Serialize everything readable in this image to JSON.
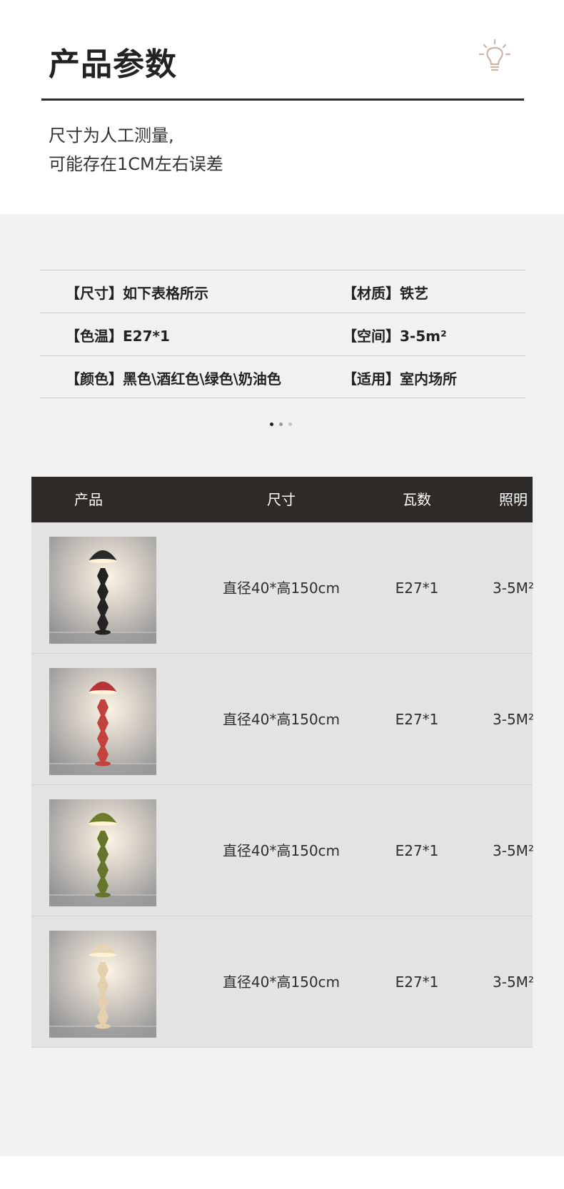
{
  "header": {
    "title": "产品参数",
    "icon": "bulb-icon",
    "note_line1": "尺寸为人工测量,",
    "note_line2": "可能存在1CM左右误差"
  },
  "specs": [
    {
      "left_key": "【尺寸】",
      "left_val": "如下表格所示",
      "right_key": "【材质】",
      "right_val": "铁艺"
    },
    {
      "left_key": "【色温】",
      "left_val": "E27*1",
      "right_key": "【空间】",
      "right_val": "3-5m²"
    },
    {
      "left_key": "【颜色】",
      "left_val": "黑色\\酒红色\\绿色\\奶油色",
      "right_key": "【适用】",
      "right_val": "室内场所"
    }
  ],
  "carousel": {
    "dots": 3,
    "active": 0
  },
  "table": {
    "headers": {
      "product": "产品",
      "size": "尺寸",
      "watt": "瓦数",
      "area": "照明"
    },
    "rows": [
      {
        "color_name": "black",
        "shade_color": "#2a2a2a",
        "stem_color": "#232323",
        "size": "直径40*高150cm",
        "watt": "E27*1",
        "area": "3-5M²"
      },
      {
        "color_name": "wine-red",
        "shade_color": "#b8343a",
        "stem_color": "#c2423e",
        "size": "直径40*高150cm",
        "watt": "E27*1",
        "area": "3-5M²"
      },
      {
        "color_name": "green",
        "shade_color": "#6f7c2e",
        "stem_color": "#66742c",
        "size": "直径40*高150cm",
        "watt": "E27*1",
        "area": "3-5M²"
      },
      {
        "color_name": "cream",
        "shade_color": "#e7d3b6",
        "stem_color": "#e4cfae",
        "size": "直径40*高150cm",
        "watt": "E27*1",
        "area": "3-5M²"
      }
    ]
  },
  "colors": {
    "header_bar": "#2d2a27",
    "row_bg": "#e3e3e3",
    "page_gray": "#f1f1f1"
  }
}
